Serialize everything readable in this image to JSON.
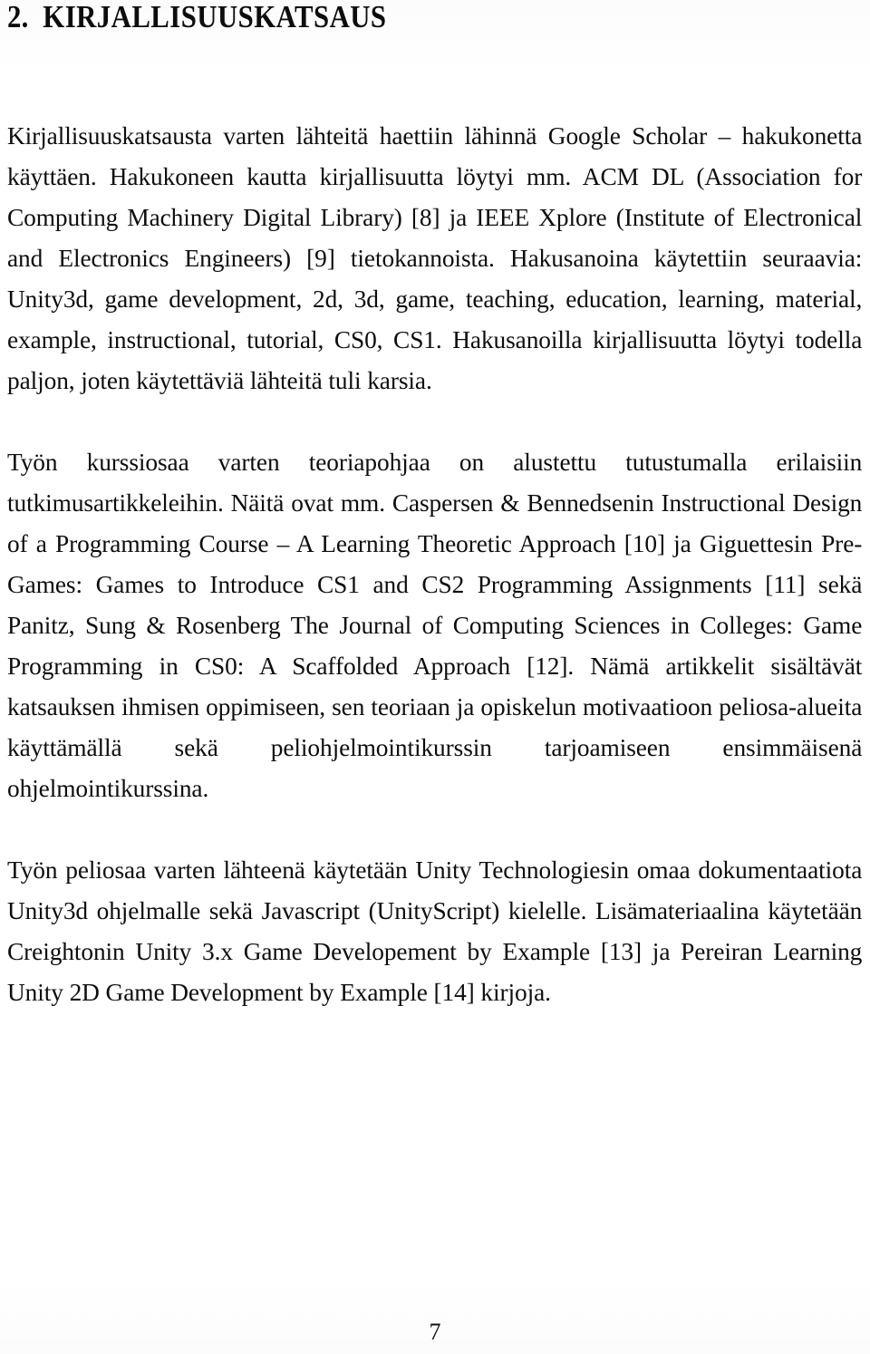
{
  "document": {
    "page_number": "7",
    "heading": {
      "number": "2.",
      "text": "KIRJALLISUUSKATSAUS"
    },
    "paragraphs": [
      {
        "id": "para-1",
        "text": "Kirjallisuuskatsausta varten lähteitä haettiin lähinnä Google Scholar – hakukonetta käyttäen. Hakukoneen kautta kirjallisuutta löytyi mm. ACM DL (Association for Computing Machinery Digital Library) [8] ja IEEE Xplore (Institute of Electronical and Electronics Engineers) [9] tietokannoista. Hakusanoina käytettiin seuraavia: Unity3d, game development, 2d, 3d, game, teaching, education, learning, material, example, instructional, tutorial, CS0, CS1. Hakusanoilla kirjallisuutta löytyi todella paljon, joten käytettäviä lähteitä tuli karsia."
      },
      {
        "id": "para-2",
        "text": "Työn kurssiosaa varten teoriapohjaa on alustettu tutustumalla erilaisiin tutkimusartikkeleihin. Näitä ovat mm. Caspersen & Bennedsenin Instructional Design of a Programming Course – A Learning Theoretic Approach [10] ja Giguettesin Pre-Games: Games to Introduce CS1 and CS2 Programming Assignments [11] sekä Panitz, Sung & Rosenberg The Journal of Computing Sciences in Colleges: Game Programming in CS0: A Scaffolded Approach [12]. Nämä artikkelit sisältävät katsauksen ihmisen oppimiseen, sen teoriaan ja opiskelun motivaatioon peliosa-alueita käyttämällä sekä peliohjelmointikurssin tarjoamiseen ensimmäisenä ohjelmointikurssina."
      },
      {
        "id": "para-3",
        "text": "Työn peliosaa varten lähteenä käytetään Unity Technologiesin omaa dokumentaatiota Unity3d ohjelmalle sekä Javascript (UnityScript) kielelle. Lisämateriaalina käytetään Creightonin Unity 3.x Game Developement by Example [13] ja Pereiran Learning Unity 2D Game Development by Example [14] kirjoja."
      }
    ]
  }
}
